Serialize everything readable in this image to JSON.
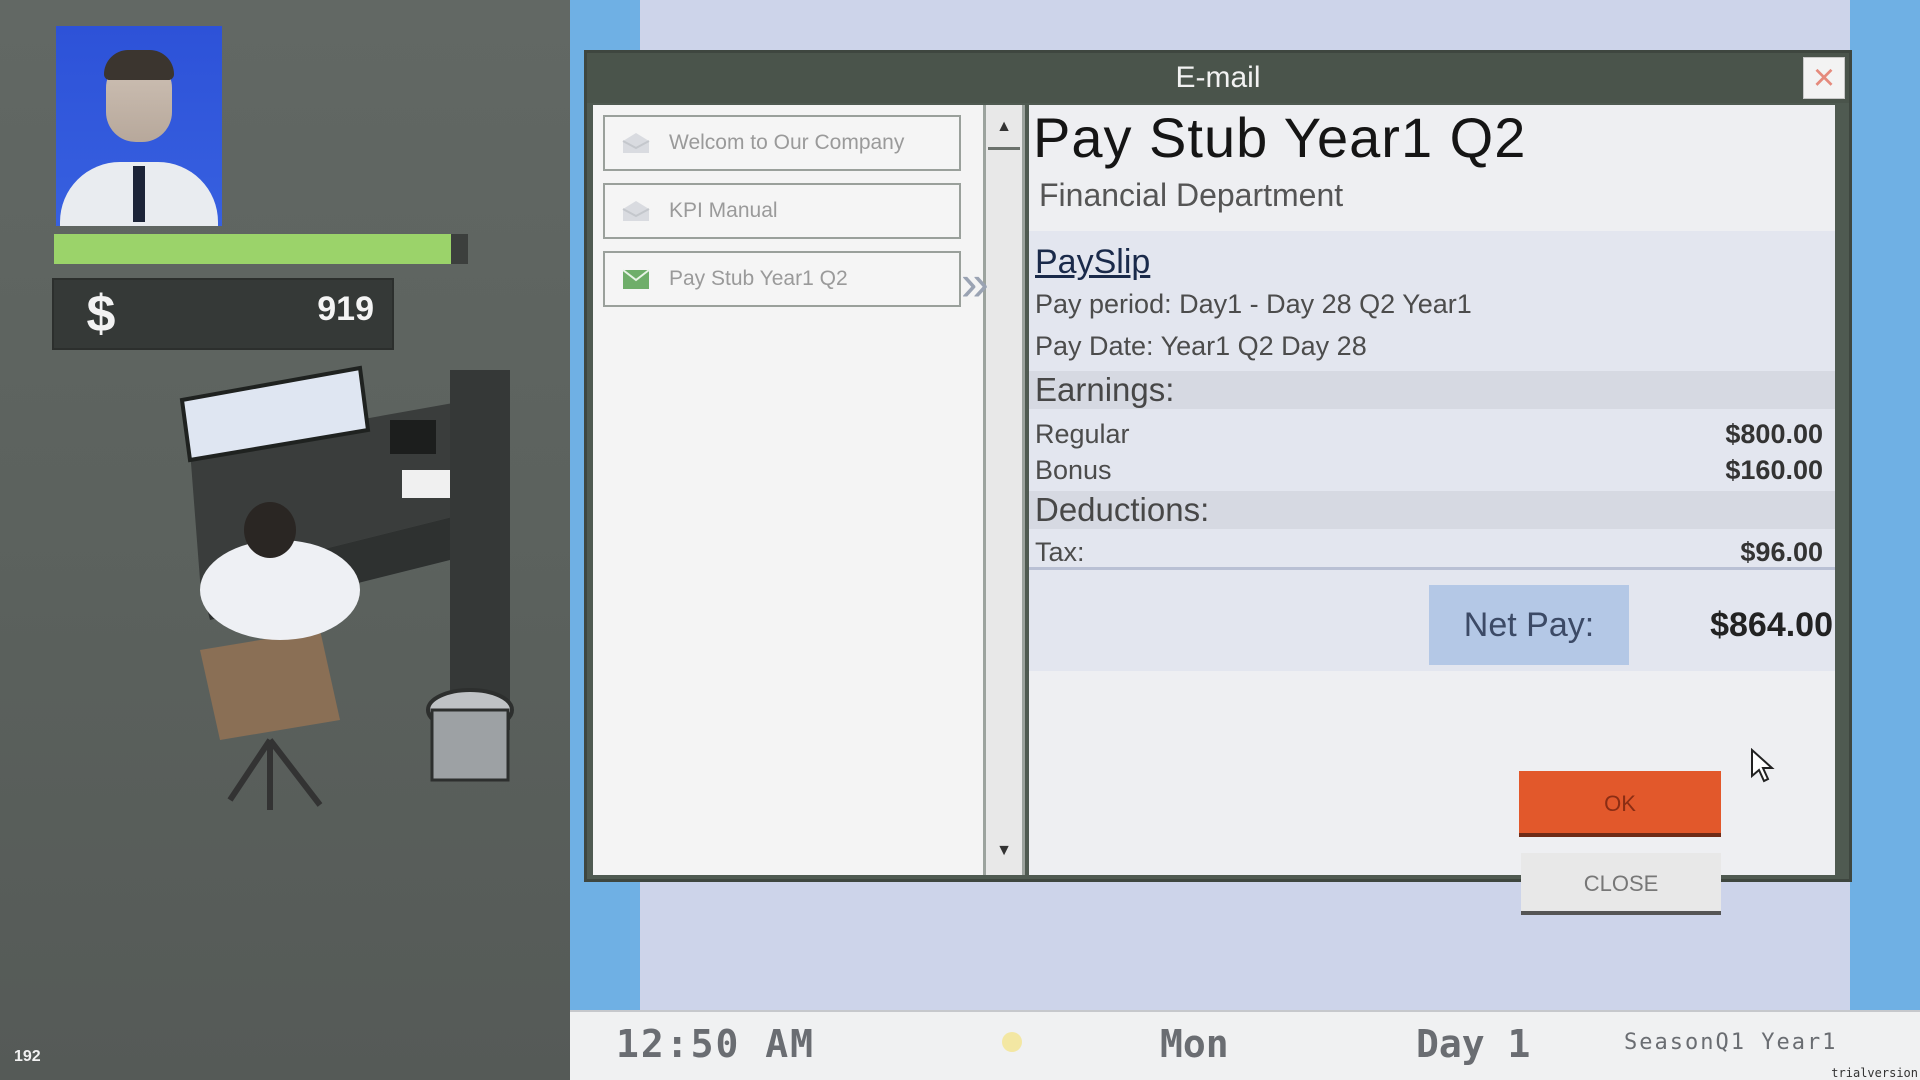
{
  "hud": {
    "health_fraction": 0.96,
    "money_icon": "$",
    "money_value": "919",
    "fps": "192",
    "colors": {
      "health": "#9bd36a",
      "portrait_bg": "#2d52d8"
    }
  },
  "email": {
    "window_title": "E-mail",
    "close_icon": "×",
    "inbox": [
      {
        "label": "Welcom to Our Company",
        "icon": "envelope-open-icon"
      },
      {
        "label": "KPI Manual",
        "icon": "envelope-open-icon"
      },
      {
        "label": "Pay Stub Year1 Q2",
        "icon": "envelope-check-icon",
        "selected": true
      }
    ],
    "scroll_up": "▲",
    "scroll_down": "▼",
    "selected_arrow": "»",
    "message": {
      "subject": "Pay Stub Year1 Q2",
      "sender": "Financial Department",
      "payslip_title": "PaySlip",
      "pay_period": "Pay period: Day1 - Day 28 Q2 Year1",
      "pay_date": "Pay Date: Year1 Q2 Day 28",
      "earnings_title": "Earnings:",
      "earnings": [
        {
          "label": "Regular",
          "value": "$800.00"
        },
        {
          "label": "Bonus",
          "value": "$160.00"
        }
      ],
      "deductions_title": "Deductions:",
      "deductions": [
        {
          "label": "Tax:",
          "value": "$96.00"
        }
      ],
      "net_pay_label": "Net Pay:",
      "net_pay_value": "$864.00"
    },
    "ok_label": "OK",
    "close_label": "CLOSE",
    "colors": {
      "ok": "#e2582b",
      "net_pay_box": "#b4c8e6"
    }
  },
  "status": {
    "time": "12:50 AM",
    "weekday": "Mon",
    "day": "Day 1",
    "season": "SeasonQ1 Year1",
    "trial": "trialversion"
  }
}
